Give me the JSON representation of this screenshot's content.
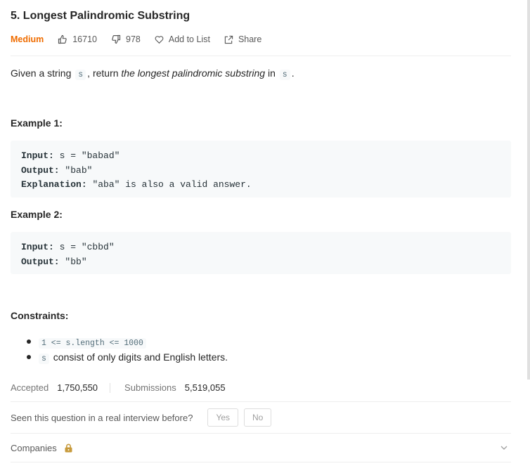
{
  "problem": {
    "title": "5. Longest Palindromic Substring",
    "difficulty": "Medium",
    "likes": "16710",
    "dislikes": "978",
    "add_to_list": "Add to List",
    "share": "Share"
  },
  "description": {
    "part1": "Given a string",
    "var1": "s",
    "part2": ", return",
    "emphasis": "the longest palindromic substring",
    "part3": "in",
    "var2": "s",
    "part4": "."
  },
  "examples": [
    {
      "title": "Example 1:",
      "input_label": "Input:",
      "input": "s = \"babad\"",
      "output_label": "Output:",
      "output": "\"bab\"",
      "explanation_label": "Explanation:",
      "explanation": "\"aba\" is also a valid answer."
    },
    {
      "title": "Example 2:",
      "input_label": "Input:",
      "input": "s = \"cbbd\"",
      "output_label": "Output:",
      "output": "\"bb\""
    }
  ],
  "constraints": {
    "title": "Constraints:",
    "c1_code": "1 <= s.length <= 1000",
    "c2_code": "s",
    "c2_text": "consist of only digits and English letters."
  },
  "stats": {
    "accepted_label": "Accepted",
    "accepted_value": "1,750,550",
    "submissions_label": "Submissions",
    "submissions_value": "5,519,055"
  },
  "interview": {
    "question": "Seen this question in a real interview before?",
    "yes": "Yes",
    "no": "No"
  },
  "companies": {
    "label": "Companies"
  },
  "colors": {
    "difficulty": "#ef6c00",
    "lock": "#c79a3b"
  }
}
